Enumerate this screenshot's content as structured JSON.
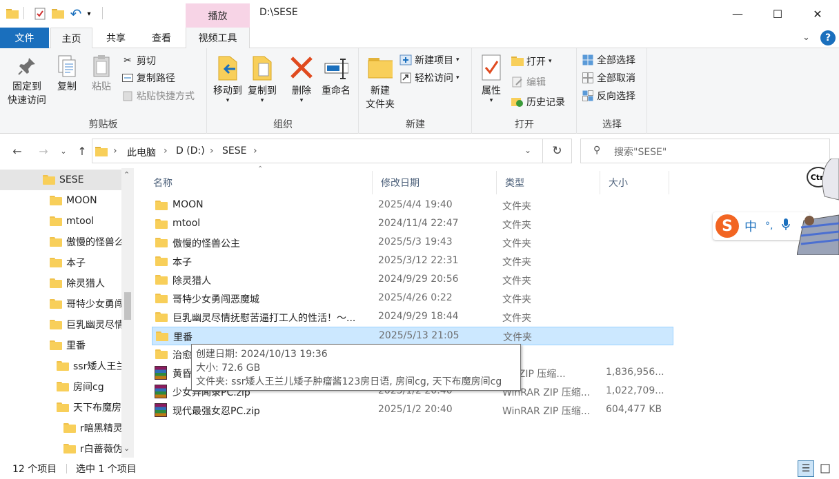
{
  "window": {
    "title": "D:\\SESE",
    "context_tab": "播放",
    "controls": {
      "minimize": "—",
      "maximize": "☐",
      "close": "✕"
    }
  },
  "tabs": {
    "file": "文件",
    "home": "主页",
    "share": "共享",
    "view": "查看",
    "video_tools": "视频工具"
  },
  "ribbon": {
    "clipboard": {
      "pin_line1": "固定到",
      "pin_line2": "快速访问",
      "copy": "复制",
      "paste": "粘贴",
      "cut": "剪切",
      "copy_path": "复制路径",
      "paste_shortcut": "粘贴快捷方式",
      "label": "剪贴板"
    },
    "organize": {
      "move_to": "移动到",
      "copy_to": "复制到",
      "delete": "删除",
      "rename": "重命名",
      "label": "组织"
    },
    "new": {
      "new_folder_line1": "新建",
      "new_folder_line2": "文件夹",
      "new_item": "新建项目",
      "easy_access": "轻松访问",
      "label": "新建"
    },
    "open": {
      "properties": "属性",
      "open": "打开",
      "edit": "编辑",
      "history": "历史记录",
      "label": "打开"
    },
    "select": {
      "select_all": "全部选择",
      "select_none": "全部取消",
      "invert": "反向选择",
      "label": "选择"
    }
  },
  "address": {
    "crumbs": [
      "此电脑",
      "D (D:)",
      "SESE"
    ],
    "search_placeholder": "搜索\"SESE\""
  },
  "sidebar": {
    "items": [
      {
        "label": "SESE",
        "selected": true
      },
      {
        "label": "MOON"
      },
      {
        "label": "mtool"
      },
      {
        "label": "傲慢的怪兽么"
      },
      {
        "label": "本子"
      },
      {
        "label": "除灵猎人"
      },
      {
        "label": "哥特少女勇闯"
      },
      {
        "label": "巨乳幽灵尽情"
      },
      {
        "label": "里番"
      },
      {
        "label": "ssr矮人王兰"
      },
      {
        "label": "房间cg"
      },
      {
        "label": "天下布魔房"
      },
      {
        "label": "r暗黑精灵"
      },
      {
        "label": "r白蔷薇伪"
      }
    ]
  },
  "columns": {
    "name": "名称",
    "date": "修改日期",
    "type": "类型",
    "size": "大小"
  },
  "files": [
    {
      "name": "MOON",
      "date": "2025/4/4 19:40",
      "type": "文件夹",
      "size": "",
      "kind": "folder"
    },
    {
      "name": "mtool",
      "date": "2024/11/4 22:47",
      "type": "文件夹",
      "size": "",
      "kind": "folder"
    },
    {
      "name": "傲慢的怪兽公主",
      "date": "2025/5/3 19:43",
      "type": "文件夹",
      "size": "",
      "kind": "folder"
    },
    {
      "name": "本子",
      "date": "2025/3/12 22:31",
      "type": "文件夹",
      "size": "",
      "kind": "folder"
    },
    {
      "name": "除灵猎人",
      "date": "2024/9/29 20:56",
      "type": "文件夹",
      "size": "",
      "kind": "folder"
    },
    {
      "name": "哥特少女勇闯恶魔城",
      "date": "2025/4/26 0:22",
      "type": "文件夹",
      "size": "",
      "kind": "folder"
    },
    {
      "name": "巨乳幽灵尽情抚慰苦逼打工人的性活！～...",
      "date": "2024/9/29 18:44",
      "type": "文件夹",
      "size": "",
      "kind": "folder"
    },
    {
      "name": "里番",
      "date": "2025/5/13 21:05",
      "type": "文件夹",
      "size": "",
      "kind": "folder",
      "selected": true
    },
    {
      "name": "治愈",
      "date": "",
      "type": "夹",
      "size": "",
      "kind": "folder"
    },
    {
      "name": "黄昏",
      "date": "",
      "type": "AR ZIP 压缩...",
      "size": "1,836,956...",
      "kind": "zip"
    },
    {
      "name": "少女异闻录PC.zip",
      "date": "2025/1/2 20:40",
      "type": "WinRAR ZIP 压缩...",
      "size": "1,022,709...",
      "kind": "zip"
    },
    {
      "name": "现代最强女忍PC.zip",
      "date": "2025/1/2 20:40",
      "type": "WinRAR ZIP 压缩...",
      "size": "604,477 KB",
      "kind": "zip"
    }
  ],
  "tooltip": {
    "created": "创建日期: 2024/10/13 19:36",
    "size": "大小: 72.6 GB",
    "folders": "文件夹: ssr矮人王兰儿矮子肿瘤酱123房日语, 房间cg, 天下布魔房间cg"
  },
  "status": {
    "count": "12 个项目",
    "selected": "选中 1 个项目"
  },
  "ime": {
    "mode": "中",
    "punct": "°,"
  },
  "overlay": {
    "ctrl_label": "Ctrl"
  },
  "colors": {
    "accent": "#1a6fbd",
    "selection": "#cce8ff",
    "context_tab": "#f7d4e6",
    "folder": "#f8cf5a"
  }
}
